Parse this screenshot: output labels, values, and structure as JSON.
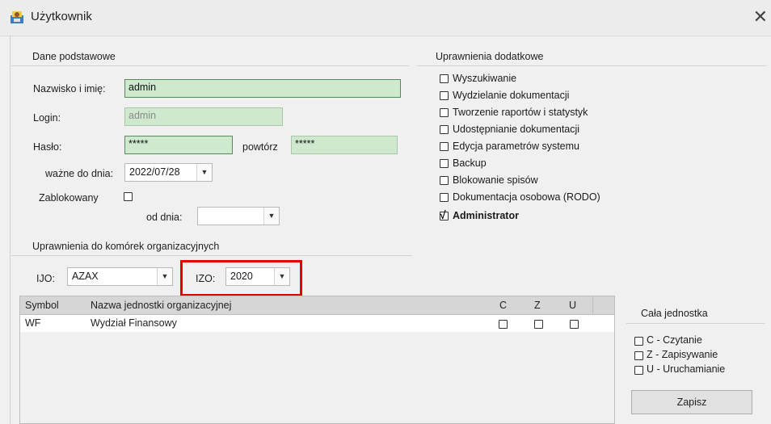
{
  "window": {
    "title": "Użytkownik",
    "close_glyph": "✕"
  },
  "basic": {
    "section": "Dane podstawowe",
    "name_label": "Nazwisko i imię:",
    "name_value": "admin",
    "login_label": "Login:",
    "login_value": "admin",
    "password_label": "Hasło:",
    "password_value": "*****",
    "repeat_label": "powtórz",
    "repeat_value": "*****",
    "valid_label": "ważne do dnia:",
    "valid_value": "2022/07/28",
    "blocked_label": "Zablokowany",
    "blocked_checked": false,
    "from_label": "od dnia:",
    "from_value": ""
  },
  "extra": {
    "section": "Uprawnienia dodatkowe",
    "items": [
      {
        "label": "Wyszukiwanie",
        "checked": false
      },
      {
        "label": "Wydzielanie dokumentacji",
        "checked": false
      },
      {
        "label": "Tworzenie raportów i statystyk",
        "checked": false
      },
      {
        "label": "Udostępnianie dokumentacji",
        "checked": false
      },
      {
        "label": "Edycja parametrów systemu",
        "checked": false
      },
      {
        "label": "Backup",
        "checked": false
      },
      {
        "label": "Blokowanie spisów",
        "checked": false
      },
      {
        "label": "Dokumentacja osobowa (RODO)",
        "checked": false
      },
      {
        "label": "Administrator",
        "checked": true
      }
    ]
  },
  "org": {
    "section": "Uprawnienia do komórek organizacyjnych",
    "ijo_label": "IJO:",
    "ijo_value": "AZAX",
    "izo_label": "IZO:",
    "izo_value": "2020",
    "columns": {
      "symbol": "Symbol",
      "name": "Nazwa jednostki organizacyjnej",
      "c": "C",
      "z": "Z",
      "u": "U"
    },
    "rows": [
      {
        "symbol": "WF",
        "name": "Wydział Finansowy",
        "c": false,
        "z": false,
        "u": false
      }
    ]
  },
  "whole": {
    "section": "Cała jednostka",
    "read": "C - Czytanie",
    "write": "Z - Zapisywanie",
    "run": "U - Uruchamianie",
    "save": "Zapisz"
  },
  "colors": {
    "input_bg": "#cfe9cf",
    "highlight": "#e30000"
  }
}
